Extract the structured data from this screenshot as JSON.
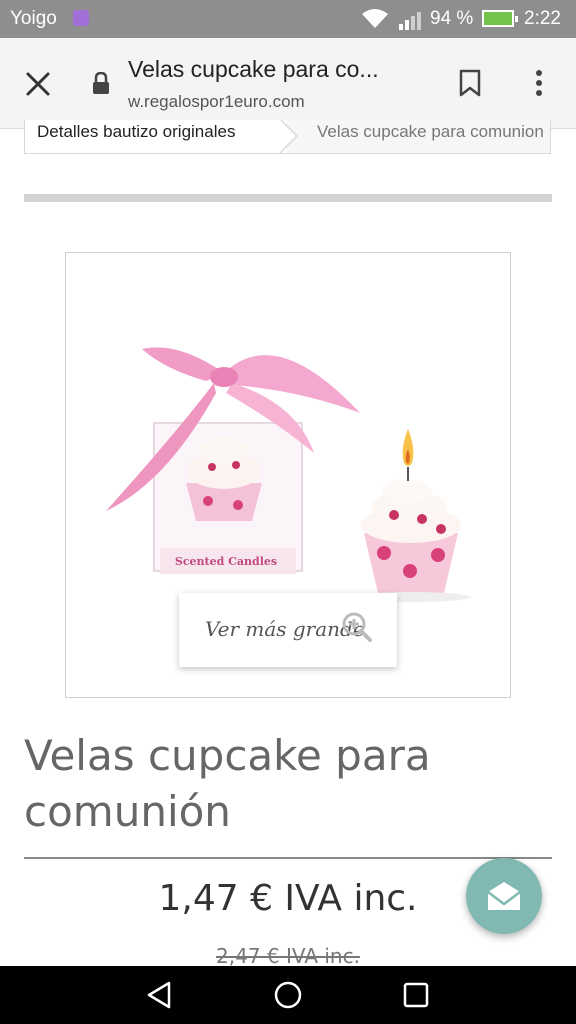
{
  "status_bar": {
    "carrier": "Yoigo",
    "battery_percent": "94 %",
    "time": "2:22"
  },
  "browser": {
    "page_title": "Velas cupcake para co...",
    "url": "w.regalospor1euro.com"
  },
  "breadcrumb": {
    "items": [
      "Detalles bautizo originales",
      "Velas cupcake para comunion"
    ]
  },
  "product": {
    "box_label": "Scented Candles",
    "zoom_label": "Ver más grande",
    "title": "Velas cupcake para comunión",
    "price": "1,47 € IVA inc.",
    "old_price": "2,47 € IVA inc."
  },
  "colors": {
    "accent_fab": "#7fb9b2",
    "status_bar": "#8e8e8e",
    "ribbon_pink": "#f09cc6"
  },
  "icons": [
    "close-icon",
    "lock-icon",
    "bookmark-icon",
    "more-vert-icon",
    "zoom-in-icon",
    "mail-icon",
    "back-icon",
    "home-icon",
    "recent-apps-icon"
  ]
}
